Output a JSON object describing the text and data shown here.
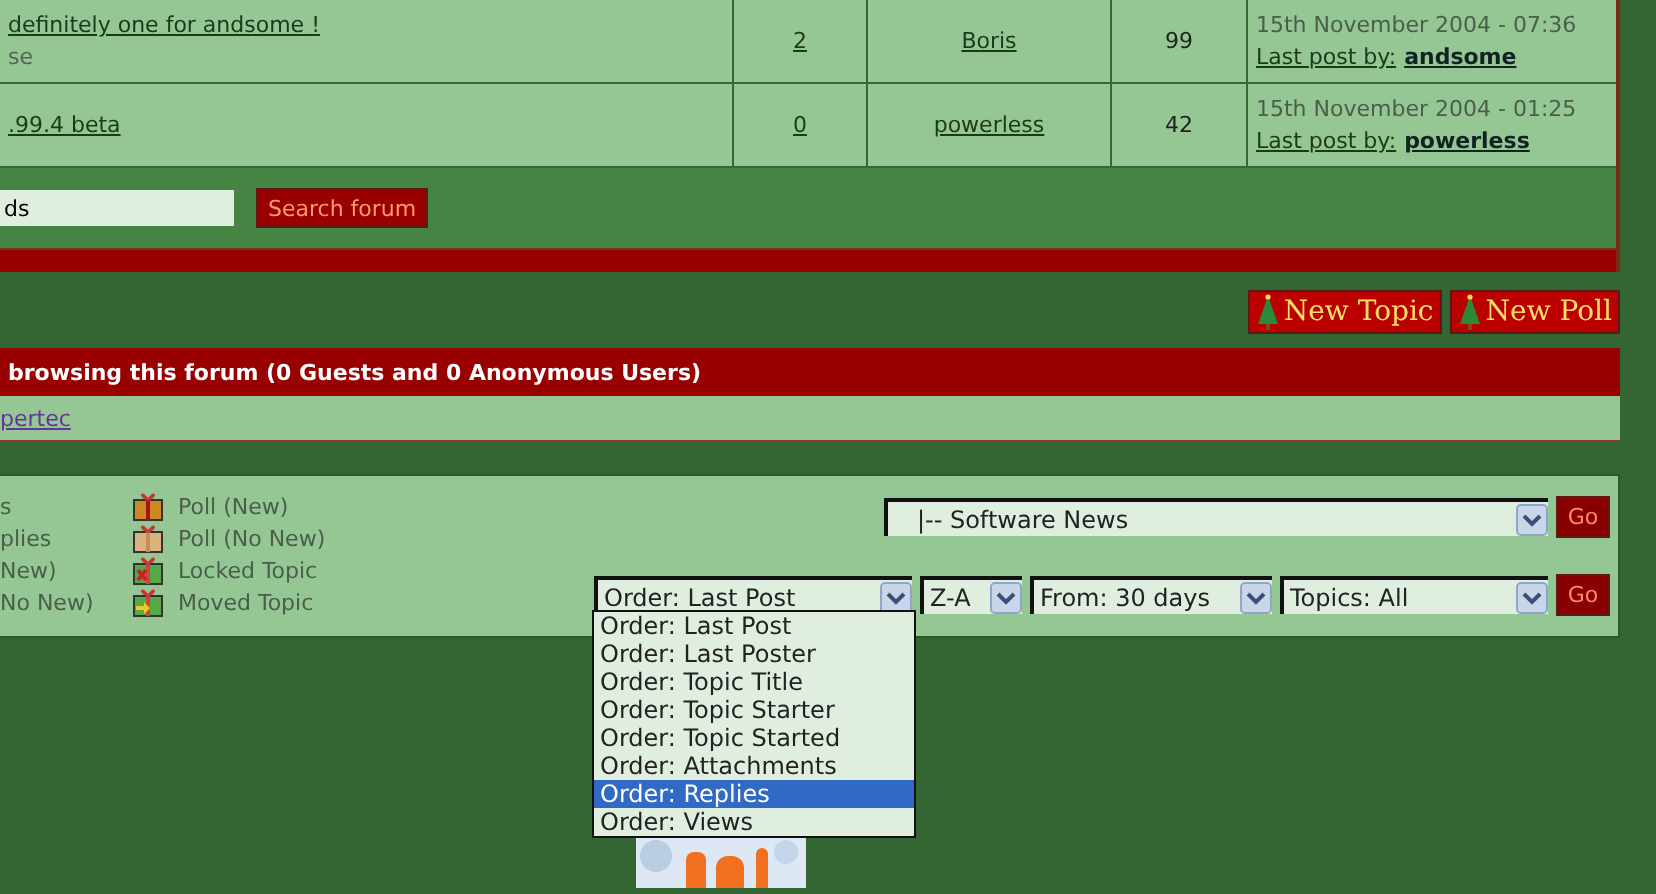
{
  "topics": [
    {
      "title": "definitely one for andsome !",
      "description": "se",
      "replies": "2",
      "starter": "Boris",
      "views": "99",
      "date": "15th November 2004 - 07:36",
      "last_post_label": "Last post by:",
      "last_poster": "andsome"
    },
    {
      "title": ".99.4 beta",
      "replies": "0",
      "starter": "powerless",
      "views": "42",
      "date": "15th November 2004 - 01:25",
      "last_post_label": "Last post by:",
      "last_poster": "powerless"
    }
  ],
  "search": {
    "value": "ds",
    "button": "Search forum"
  },
  "actions": [
    "New Topic",
    "New Poll"
  ],
  "active_users": {
    "header": "browsing this forum (0 Guests and 0 Anonymous Users)",
    "users": [
      "pertec"
    ]
  },
  "legend": {
    "left": [
      "s",
      "plies",
      "New)",
      "No New)"
    ],
    "right": [
      {
        "label": "Poll (New)",
        "kind": "poll-new"
      },
      {
        "label": "Poll (No New)",
        "kind": "poll-old"
      },
      {
        "label": "Locked Topic",
        "kind": "locked"
      },
      {
        "label": "Moved Topic",
        "kind": "moved"
      }
    ]
  },
  "jump": {
    "forum": "|-- Software News",
    "go": "Go"
  },
  "sort": {
    "order": "Order: Last Post",
    "direction": "Z-A",
    "from": "From: 30 days",
    "topics": "Topics: All",
    "go": "Go",
    "options": [
      {
        "label": "Order: Last Post",
        "selected": false
      },
      {
        "label": "Order: Last Poster",
        "selected": false
      },
      {
        "label": "Order: Topic Title",
        "selected": false
      },
      {
        "label": "Order: Topic Starter",
        "selected": false
      },
      {
        "label": "Order: Topic Started",
        "selected": false
      },
      {
        "label": "Order: Attachments",
        "selected": false
      },
      {
        "label": "Order: Replies",
        "selected": true
      },
      {
        "label": "Order: Views",
        "selected": false
      }
    ]
  }
}
